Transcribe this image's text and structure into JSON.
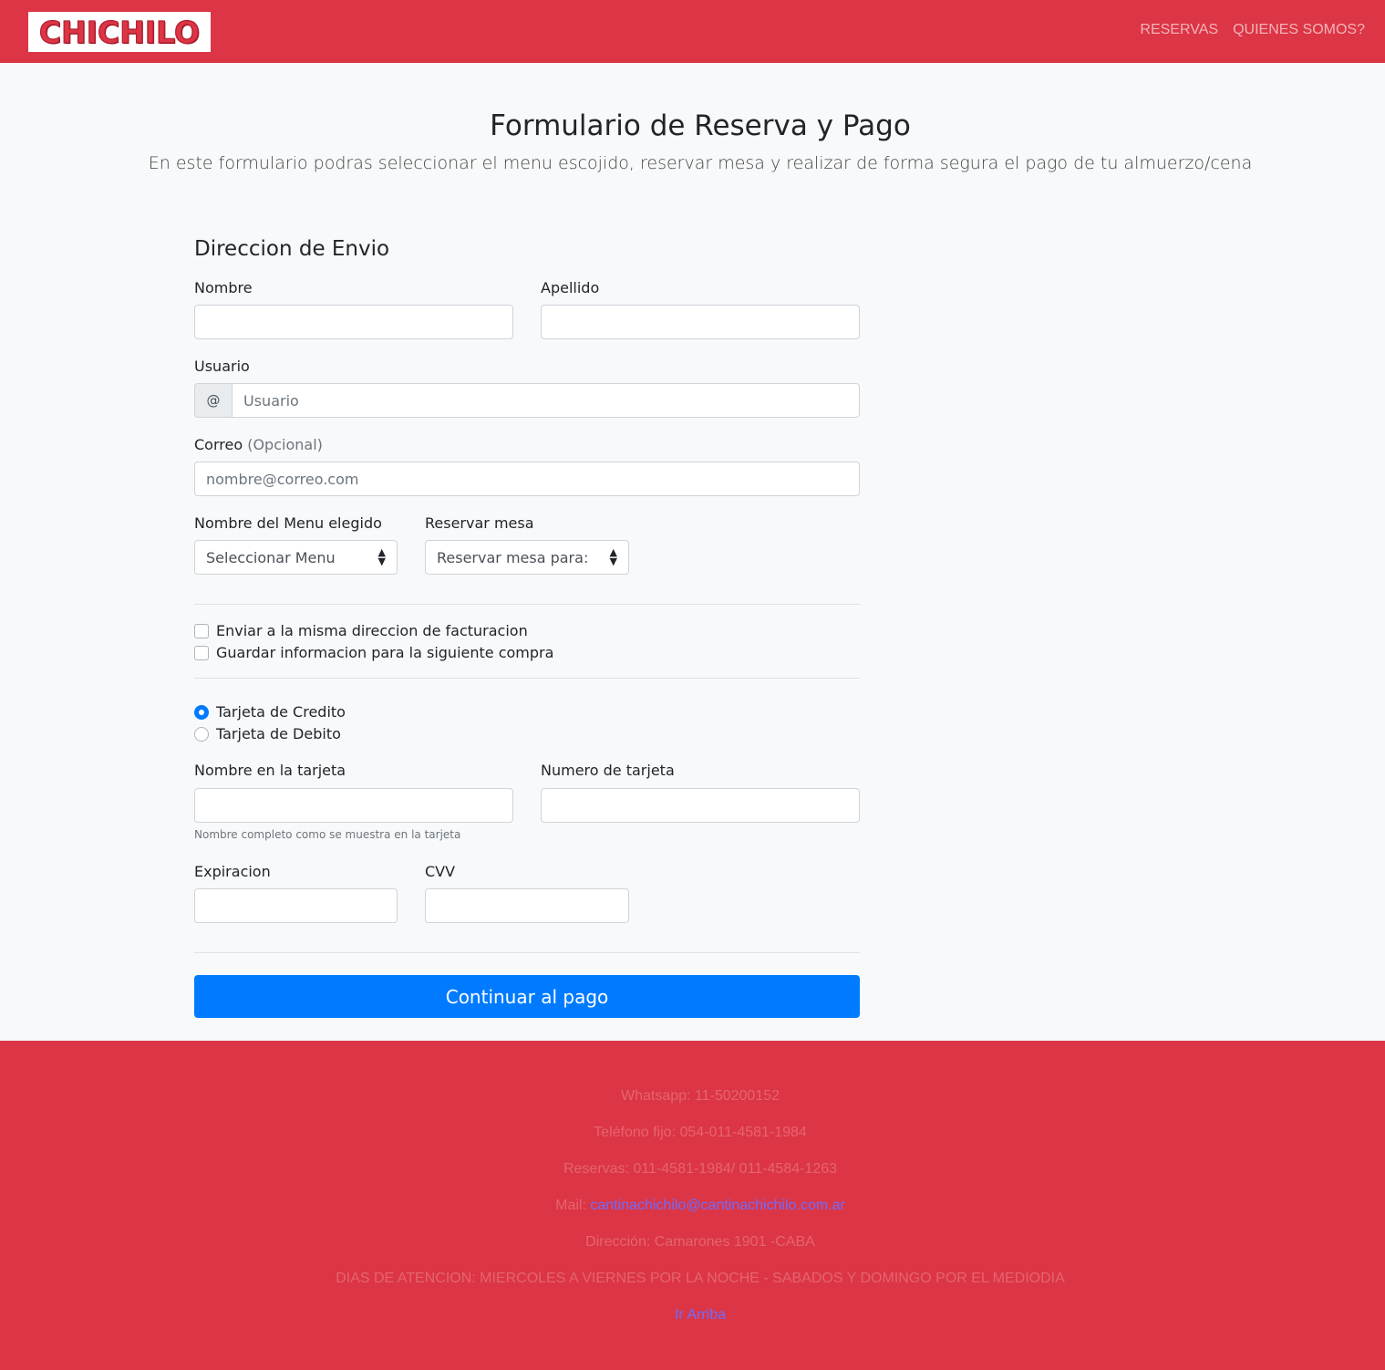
{
  "navbar": {
    "logo_text": "CHICHILO",
    "links": [
      "RESERVAS",
      "QUIENES SOMOS?"
    ]
  },
  "header": {
    "title": "Formulario de Reserva y Pago",
    "lead": "En este formulario podras seleccionar el menu escojido, reservar mesa y realizar de forma segura el pago de tu almuerzo/cena"
  },
  "form": {
    "section_title": "Direccion de Envio",
    "first_name_label": "Nombre",
    "first_name_value": "",
    "last_name_label": "Apellido",
    "last_name_value": "",
    "username_label": "Usuario",
    "username_prefix": "@",
    "username_placeholder": "Usuario",
    "email_label": "Correo",
    "email_optional": "(Opcional)",
    "email_placeholder": "nombre@correo.com",
    "menu_label": "Nombre del Menu elegido",
    "menu_selected": "Seleccionar Menu",
    "table_label": "Reservar mesa",
    "table_selected": "Reservar mesa para:",
    "checkboxes": [
      {
        "label": "Enviar a la misma direccion de facturacion",
        "checked": false
      },
      {
        "label": "Guardar informacion para la siguiente compra",
        "checked": false
      }
    ],
    "payment_methods": [
      {
        "label": "Tarjeta de Credito",
        "checked": true
      },
      {
        "label": "Tarjeta de Debito",
        "checked": false
      }
    ],
    "card_name_label": "Nombre en la tarjeta",
    "card_name_help": "Nombre completo como se muestra en la tarjeta",
    "card_number_label": "Numero de tarjeta",
    "expiration_label": "Expiracion",
    "cvv_label": "CVV",
    "submit_label": "Continuar al pago"
  },
  "footer": {
    "whatsapp": "Whatsapp: 11-50200152",
    "phone": "Teléfono fijo: 054-011-4581-1984",
    "reservations": "Reservas: 011-4581-1984/ 011-4584-1263",
    "mail_prefix": "Mail: ",
    "mail_link": "cantinachichilo@cantinachichilo.com.ar",
    "address": "Dirección: Camarones 1901 -CABA",
    "hours": "DIAS DE ATENCION: MIERCOLES A VIERNES POR LA NOCHE - SABADOS Y DOMINGO POR EL MEDIODIA",
    "back_to_top": "Ir Arriba"
  },
  "colors": {
    "brand_red": "#dc3545",
    "primary_blue": "#007bff",
    "page_bg": "#f8f9fa"
  },
  "icons": {
    "select_caret": "updown-caret-icon"
  }
}
